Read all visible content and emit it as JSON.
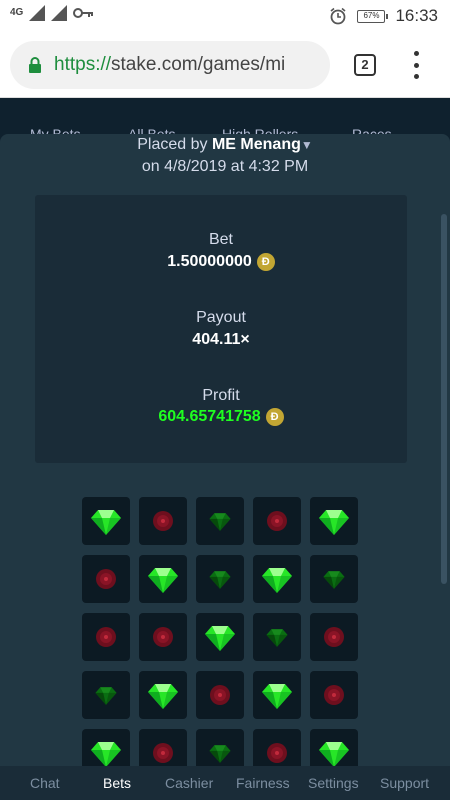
{
  "status_bar": {
    "network": "4G",
    "battery": "67%",
    "time": "16:33",
    "icons": [
      "signal-icon",
      "signal-icon",
      "key-icon",
      "alarm-icon",
      "battery-icon"
    ]
  },
  "browser": {
    "url_scheme": "https://",
    "url_rest": "stake.com/games/mi",
    "tab_count": "2"
  },
  "background_tabs": [
    "My Bets",
    "All Bets",
    "High Rollers",
    "Races"
  ],
  "bet": {
    "placed_by_label": "Placed by",
    "user": "ME Menang",
    "date_text": "on 4/8/2019 at 4:32 PM",
    "bet_label": "Bet",
    "bet_amount": "1.50000000",
    "payout_label": "Payout",
    "payout_value": "404.11×",
    "profit_label": "Profit",
    "profit_value": "604.65741758",
    "currency_symbol": "Đ",
    "currency_color": "#c2a633",
    "profit_color": "#1fff20"
  },
  "mines_grid": [
    [
      "gem-bright",
      "mine-dim",
      "gem-dim",
      "mine-dim",
      "gem-bright"
    ],
    [
      "mine-dim",
      "gem-bright",
      "gem-dim",
      "gem-bright",
      "gem-dim"
    ],
    [
      "mine-dim",
      "mine-dim",
      "gem-bright",
      "gem-dim",
      "mine-dim"
    ],
    [
      "gem-dim",
      "gem-bright",
      "mine-dim",
      "gem-bright",
      "mine-dim"
    ],
    [
      "gem-bright",
      "mine-dim",
      "gem-dim",
      "mine-dim",
      "gem-bright"
    ]
  ],
  "bottom_nav": {
    "items": [
      "Chat",
      "Bets",
      "Cashier",
      "Fairness",
      "Settings",
      "Support"
    ],
    "active": "Bets"
  }
}
